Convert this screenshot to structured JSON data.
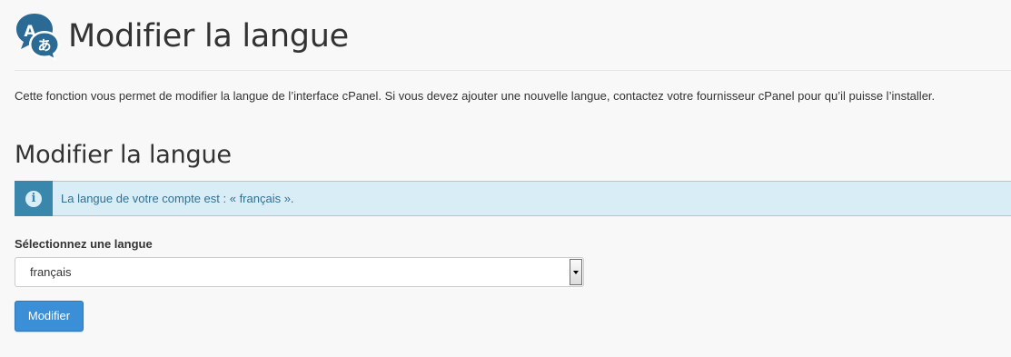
{
  "header": {
    "title": "Modifier la langue",
    "icon": "language-translate-icon",
    "icon_glyphs": {
      "latin": "A",
      "japanese": "あ"
    },
    "icon_color": "#2a6a94"
  },
  "description": "Cette fonction vous permet de modifier la langue de l’interface cPanel. Si vous devez ajouter une nouvelle langue, contactez votre fournisseur cPanel pour qu’il puisse l’installer.",
  "section": {
    "title": "Modifier la langue"
  },
  "alert": {
    "icon": "info-icon",
    "icon_glyph": "i",
    "text": "La langue de votre compte est : « français ».",
    "background": "#d9edf7",
    "accent": "#3a87ad"
  },
  "form": {
    "label": "Sélectionnez une langue",
    "selected_value": "français",
    "dropdown_icon": "chevron-down-icon",
    "submit_label": "Modifier",
    "submit_color": "#3b8fd6"
  }
}
